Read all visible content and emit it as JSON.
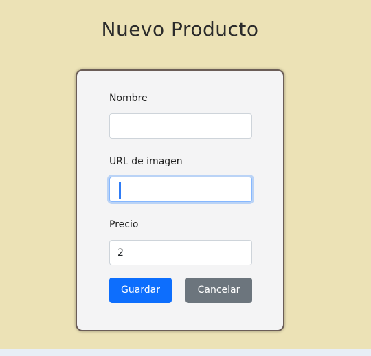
{
  "page": {
    "title": "Nuevo Producto"
  },
  "form": {
    "name": {
      "label": "Nombre",
      "value": ""
    },
    "image_url": {
      "label": "URL de imagen",
      "value": ""
    },
    "price": {
      "label": "Precio",
      "value": "2"
    },
    "save_label": "Guardar",
    "cancel_label": "Cancelar"
  },
  "colors": {
    "page_background": "#ece2b6",
    "card_background": "#f4f4f5",
    "card_border": "#6b5d57",
    "primary": "#0d6efd",
    "secondary": "#6c757d",
    "focus": "#86b7fe"
  }
}
